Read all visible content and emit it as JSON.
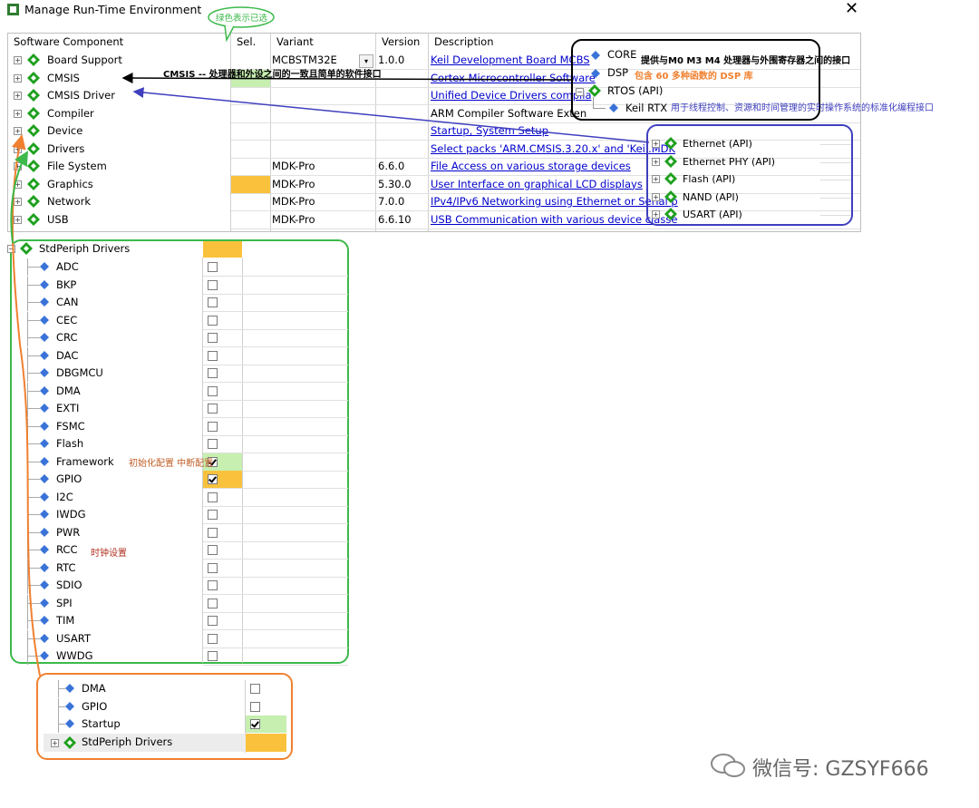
{
  "window": {
    "title": "Manage Run-Time Environment",
    "close_glyph": "✕"
  },
  "header": {
    "component": "Software Component",
    "sel": "Sel.",
    "variant": "Variant",
    "version": "Version",
    "description": "Description"
  },
  "components": [
    {
      "name": "Board Support",
      "variant": "MCBSTM32E",
      "version": "1.0.0",
      "description": "Keil Development Board MCBS",
      "link": true
    },
    {
      "name": "CMSIS",
      "variant": "",
      "version": "",
      "description": "Cortex Microcontroller Software",
      "link": true
    },
    {
      "name": "CMSIS Driver",
      "variant": "",
      "version": "",
      "description": "Unified Device Drivers complia",
      "link": true
    },
    {
      "name": "Compiler",
      "variant": "",
      "version": "",
      "description": "ARM Compiler Software Exten",
      "link": false
    },
    {
      "name": "Device",
      "variant": "",
      "version": "",
      "description": "Startup, System Setup",
      "link": true
    },
    {
      "name": "Drivers",
      "variant": "",
      "version": "",
      "description": "Select packs 'ARM.CMSIS.3.20.x' and 'Keil.MDK",
      "link": true
    },
    {
      "name": "File System",
      "variant": "MDK-Pro",
      "version": "6.6.0",
      "description": "File Access on various storage devices",
      "link": true
    },
    {
      "name": "Graphics",
      "variant": "MDK-Pro",
      "version": "5.30.0",
      "description": "User Interface on graphical LCD displays",
      "link": true
    },
    {
      "name": "Network",
      "variant": "MDK-Pro",
      "version": "7.0.0",
      "description": "IPv4/IPv6 Networking using Ethernet or Serial p",
      "link": true
    },
    {
      "name": "USB",
      "variant": "MDK-Pro",
      "version": "6.6.10",
      "description": "USB Communication with various device classe",
      "link": true
    }
  ],
  "green_note": "绿色表示已选",
  "cmsis_note": "CMSIS -- 处理器和外设之间的一致且简单的软件接口",
  "cmsis_box": {
    "core": "CORE",
    "core_note": "提供与M0 M3 M4 处理器与外围寄存器之间的接口",
    "dsp": "DSP",
    "dsp_note": "包含 60 多种函数的 DSP 库",
    "rtos": "RTOS (API)",
    "keil_rtx": "Keil RTX",
    "rtx_note": "用于线程控制、资源和时间管理的实时操作系统的标准化编程接口"
  },
  "driver_box": [
    "Ethernet (API)",
    "Ethernet PHY (API)",
    "Flash (API)",
    "NAND (API)",
    "USART (API)"
  ],
  "stdperiph": {
    "title": "StdPeriph Drivers",
    "items": [
      {
        "name": "ADC",
        "checked": false
      },
      {
        "name": "BKP",
        "checked": false
      },
      {
        "name": "CAN",
        "checked": false
      },
      {
        "name": "CEC",
        "checked": false
      },
      {
        "name": "CRC",
        "checked": false
      },
      {
        "name": "DAC",
        "checked": false
      },
      {
        "name": "DBGMCU",
        "checked": false
      },
      {
        "name": "DMA",
        "checked": false
      },
      {
        "name": "EXTI",
        "checked": false
      },
      {
        "name": "FSMC",
        "checked": false
      },
      {
        "name": "Flash",
        "checked": false
      },
      {
        "name": "Framework",
        "checked": true
      },
      {
        "name": "GPIO",
        "checked": true
      },
      {
        "name": "I2C",
        "checked": false
      },
      {
        "name": "IWDG",
        "checked": false
      },
      {
        "name": "PWR",
        "checked": false
      },
      {
        "name": "RCC",
        "checked": false
      },
      {
        "name": "RTC",
        "checked": false
      },
      {
        "name": "SDIO",
        "checked": false
      },
      {
        "name": "SPI",
        "checked": false
      },
      {
        "name": "TIM",
        "checked": false
      },
      {
        "name": "USART",
        "checked": false
      },
      {
        "name": "WWDG",
        "checked": false
      }
    ],
    "framework_note": "初始化配置 中断配置",
    "rcc_note": "时钟设置"
  },
  "device_box": {
    "items": [
      {
        "name": "DMA",
        "checked": false
      },
      {
        "name": "GPIO",
        "checked": false
      },
      {
        "name": "Startup",
        "checked": true
      }
    ],
    "stdperiph": "StdPeriph Drivers"
  },
  "watermark": "微信号: GZSYF666",
  "colors": {
    "selected_green": "#c6efb0",
    "required_orange": "#fac23c",
    "link_blue": "#0000cc",
    "gem_green": "#1ea01e",
    "gem_blue": "#3a73d8"
  }
}
